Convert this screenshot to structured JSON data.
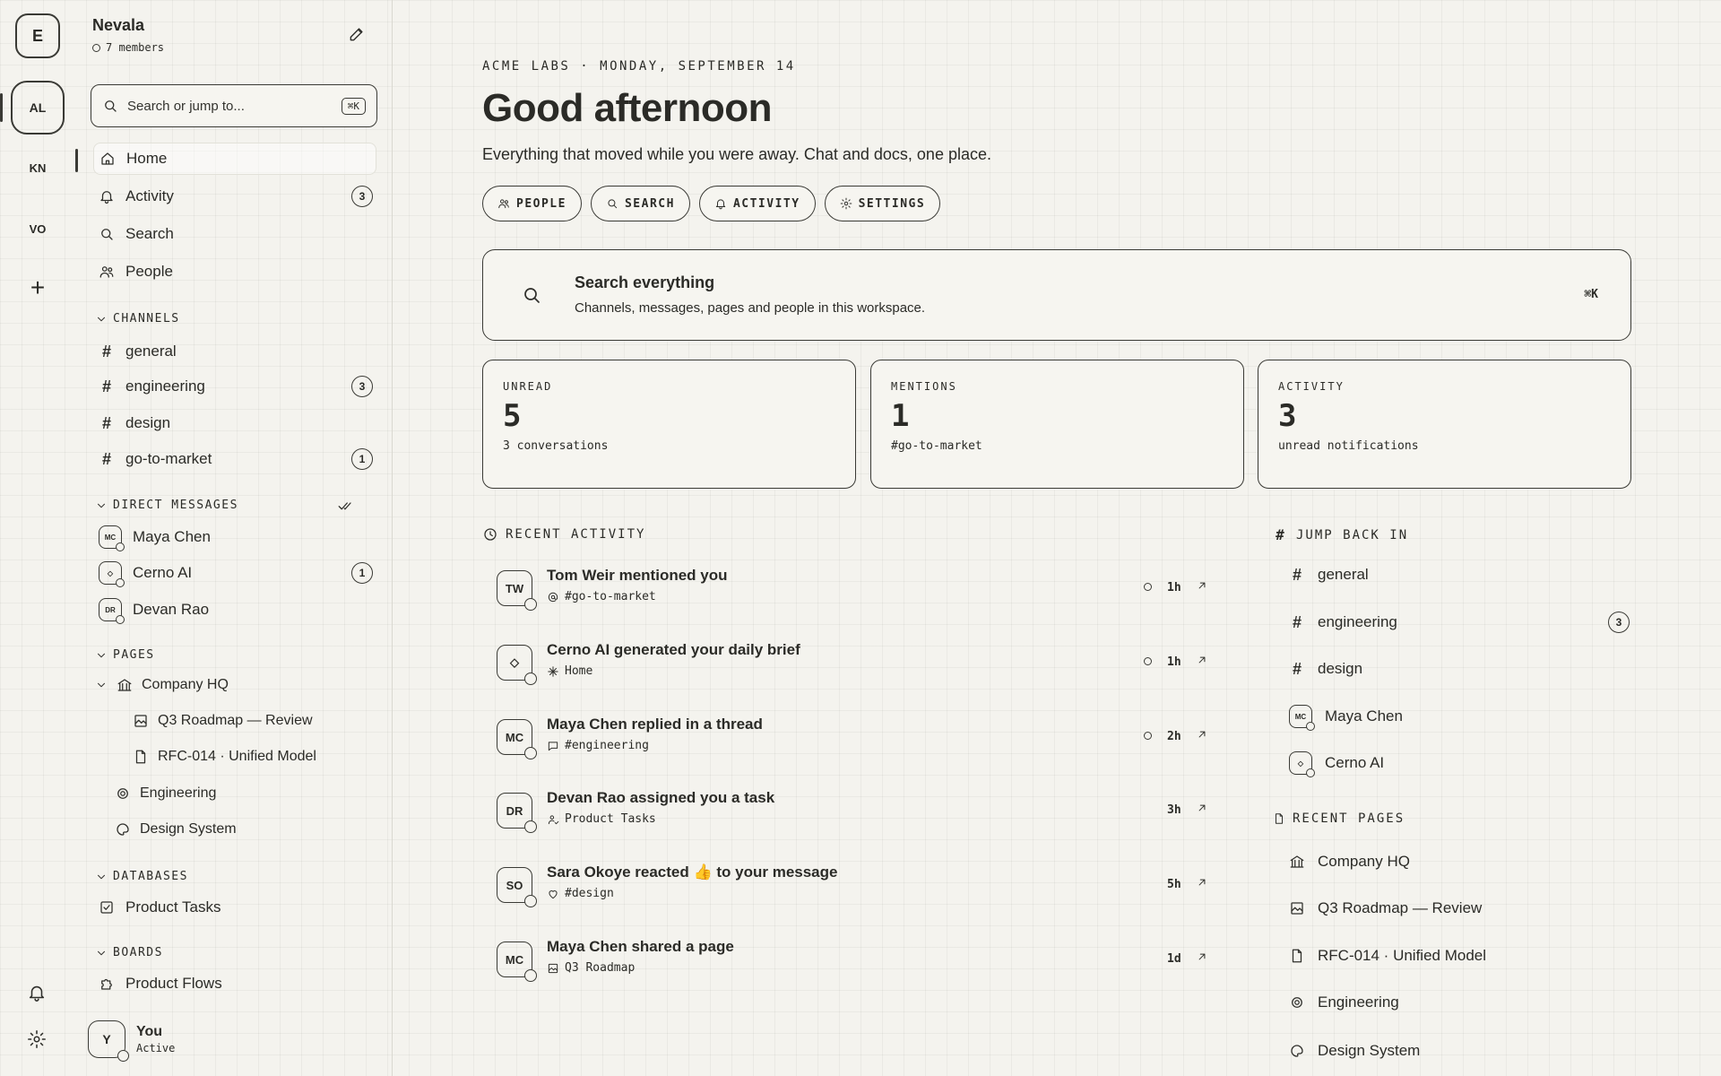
{
  "rail": {
    "workspaces": [
      "E",
      "AL",
      "KN",
      "VO"
    ],
    "add": "+"
  },
  "sidebar": {
    "workspace_name": "Nevala",
    "members": "7 members",
    "search_placeholder": "Search or jump to...",
    "search_kbd": "⌘K",
    "nav": [
      {
        "label": "Home",
        "icon": "home-icon"
      },
      {
        "label": "Activity",
        "icon": "bell-icon",
        "badge": "3"
      },
      {
        "label": "Search",
        "icon": "search-icon"
      },
      {
        "label": "People",
        "icon": "people-icon"
      }
    ],
    "channels_header": "CHANNELS",
    "channels": [
      {
        "label": "general"
      },
      {
        "label": "engineering",
        "badge": "3"
      },
      {
        "label": "design"
      },
      {
        "label": "go-to-market",
        "badge": "1"
      }
    ],
    "dm_header": "DIRECT MESSAGES",
    "dms": [
      {
        "label": "Maya Chen",
        "initials": "MC"
      },
      {
        "label": "Cerno AI",
        "initials": "◇",
        "badge": "1"
      },
      {
        "label": "Devan Rao",
        "initials": "DR"
      }
    ],
    "pages_header": "PAGES",
    "pages": {
      "root": "Company HQ",
      "children": [
        "Q3 Roadmap — Review",
        "RFC-014 · Unified Model"
      ],
      "others": [
        "Engineering",
        "Design System"
      ]
    },
    "databases_header": "DATABASES",
    "databases": [
      "Product Tasks"
    ],
    "boards_header": "BOARDS",
    "boards": [
      "Product Flows"
    ],
    "user": {
      "initial": "Y",
      "name": "You",
      "status": "Active"
    }
  },
  "main": {
    "kicker": "ACME LABS · MONDAY, SEPTEMBER 14",
    "greeting": "Good afternoon",
    "subtitle": "Everything that moved while you were away. Chat and docs, one place.",
    "pills": [
      "PEOPLE",
      "SEARCH",
      "ACTIVITY",
      "SETTINGS"
    ],
    "search": {
      "title": "Search everything",
      "subtitle": "Channels, messages, pages and people in this workspace.",
      "kbd": "⌘K"
    },
    "stats": [
      {
        "label": "UNREAD",
        "value": "5",
        "sub": "3 conversations"
      },
      {
        "label": "MENTIONS",
        "value": "1",
        "sub": "#go-to-market"
      },
      {
        "label": "ACTIVITY",
        "value": "3",
        "sub": "unread notifications"
      }
    ],
    "recent_header": "RECENT ACTIVITY",
    "activity": [
      {
        "initials": "TW",
        "title": "Tom Weir mentioned you",
        "sub": "#go-to-market",
        "time": "1h",
        "unread": true
      },
      {
        "initials": "◇",
        "title": "Cerno AI generated your daily brief",
        "sub": "Home",
        "time": "1h",
        "unread": true
      },
      {
        "initials": "MC",
        "title": "Maya Chen replied in a thread",
        "sub": "#engineering",
        "time": "2h",
        "unread": true
      },
      {
        "initials": "DR",
        "title": "Devan Rao assigned you a task",
        "sub": "Product Tasks",
        "time": "3h",
        "unread": false
      },
      {
        "initials": "SO",
        "title": "Sara Okoye reacted 👍 to your message",
        "sub": "#design",
        "time": "5h",
        "unread": false
      },
      {
        "initials": "MC",
        "title": "Maya Chen shared a page",
        "sub": "Q3 Roadmap",
        "time": "1d",
        "unread": false
      }
    ],
    "jump_header": "JUMP BACK IN",
    "jump": [
      {
        "label": "general"
      },
      {
        "label": "engineering",
        "badge": "3"
      },
      {
        "label": "design"
      },
      {
        "label": "Maya Chen"
      },
      {
        "label": "Cerno AI"
      }
    ],
    "pages_header": "RECENT PAGES",
    "recent_pages": [
      "Company HQ",
      "Q3 Roadmap — Review",
      "RFC-014 · Unified Model",
      "Engineering",
      "Design System"
    ]
  }
}
